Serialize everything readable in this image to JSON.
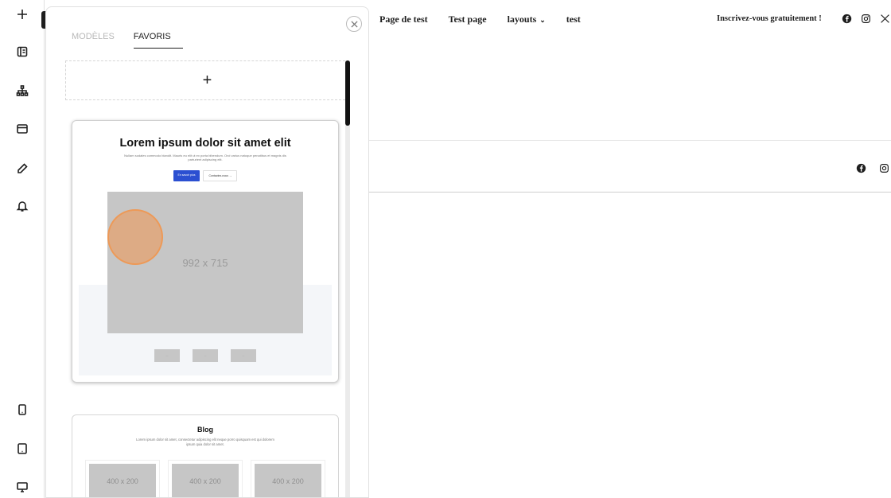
{
  "toolbar": {
    "items": [
      {
        "icon": "plus-icon"
      },
      {
        "icon": "list-view-icon"
      },
      {
        "icon": "sitemap-icon"
      },
      {
        "icon": "layout-icon"
      },
      {
        "icon": "brush-icon"
      },
      {
        "icon": "bell-icon"
      },
      {
        "icon": "mobile-icon"
      },
      {
        "icon": "tablet-icon"
      },
      {
        "icon": "desktop-icon"
      }
    ]
  },
  "panel": {
    "tabs": [
      {
        "label": "MODÈLES",
        "active": false
      },
      {
        "label": "FAVORIS",
        "active": true
      }
    ],
    "add_label": "+",
    "cards": [
      {
        "title": "Lorem ipsum dolor sit amet elit",
        "description": "Nullam sodales commodo blandit. Mauris eu elit ut ex porta bibendum. Orci varius natoque penatibus et magnis dis parturient adipiscing elit.",
        "primary_button": "En savoir plus",
        "secondary_button": "Contactez-nous →",
        "image_label": "992 x 715",
        "thumbs": [
          "---",
          "---",
          "---"
        ]
      },
      {
        "title": "Blog",
        "description": "Lorem ipsum dolor sit amet, consectetur adipiscing elit neque porro quisquam est qui dolorem ipsum quia dolor sit amet.",
        "images": [
          "400 x 200",
          "400 x 200",
          "400 x 200"
        ]
      }
    ]
  },
  "site": {
    "nav": [
      {
        "label": "Page de test"
      },
      {
        "label": "Test page"
      },
      {
        "label": "layouts",
        "dropdown": true
      },
      {
        "label": "test"
      }
    ],
    "cta": "Inscrivez-vous gratuitement !",
    "social": [
      "facebook-icon",
      "instagram-icon",
      "x-icon"
    ]
  },
  "colors": {
    "accent_blue": "#2b4fd1",
    "cursor_highlight": "#f0964f",
    "placeholder_gray": "#c6c6c6"
  }
}
